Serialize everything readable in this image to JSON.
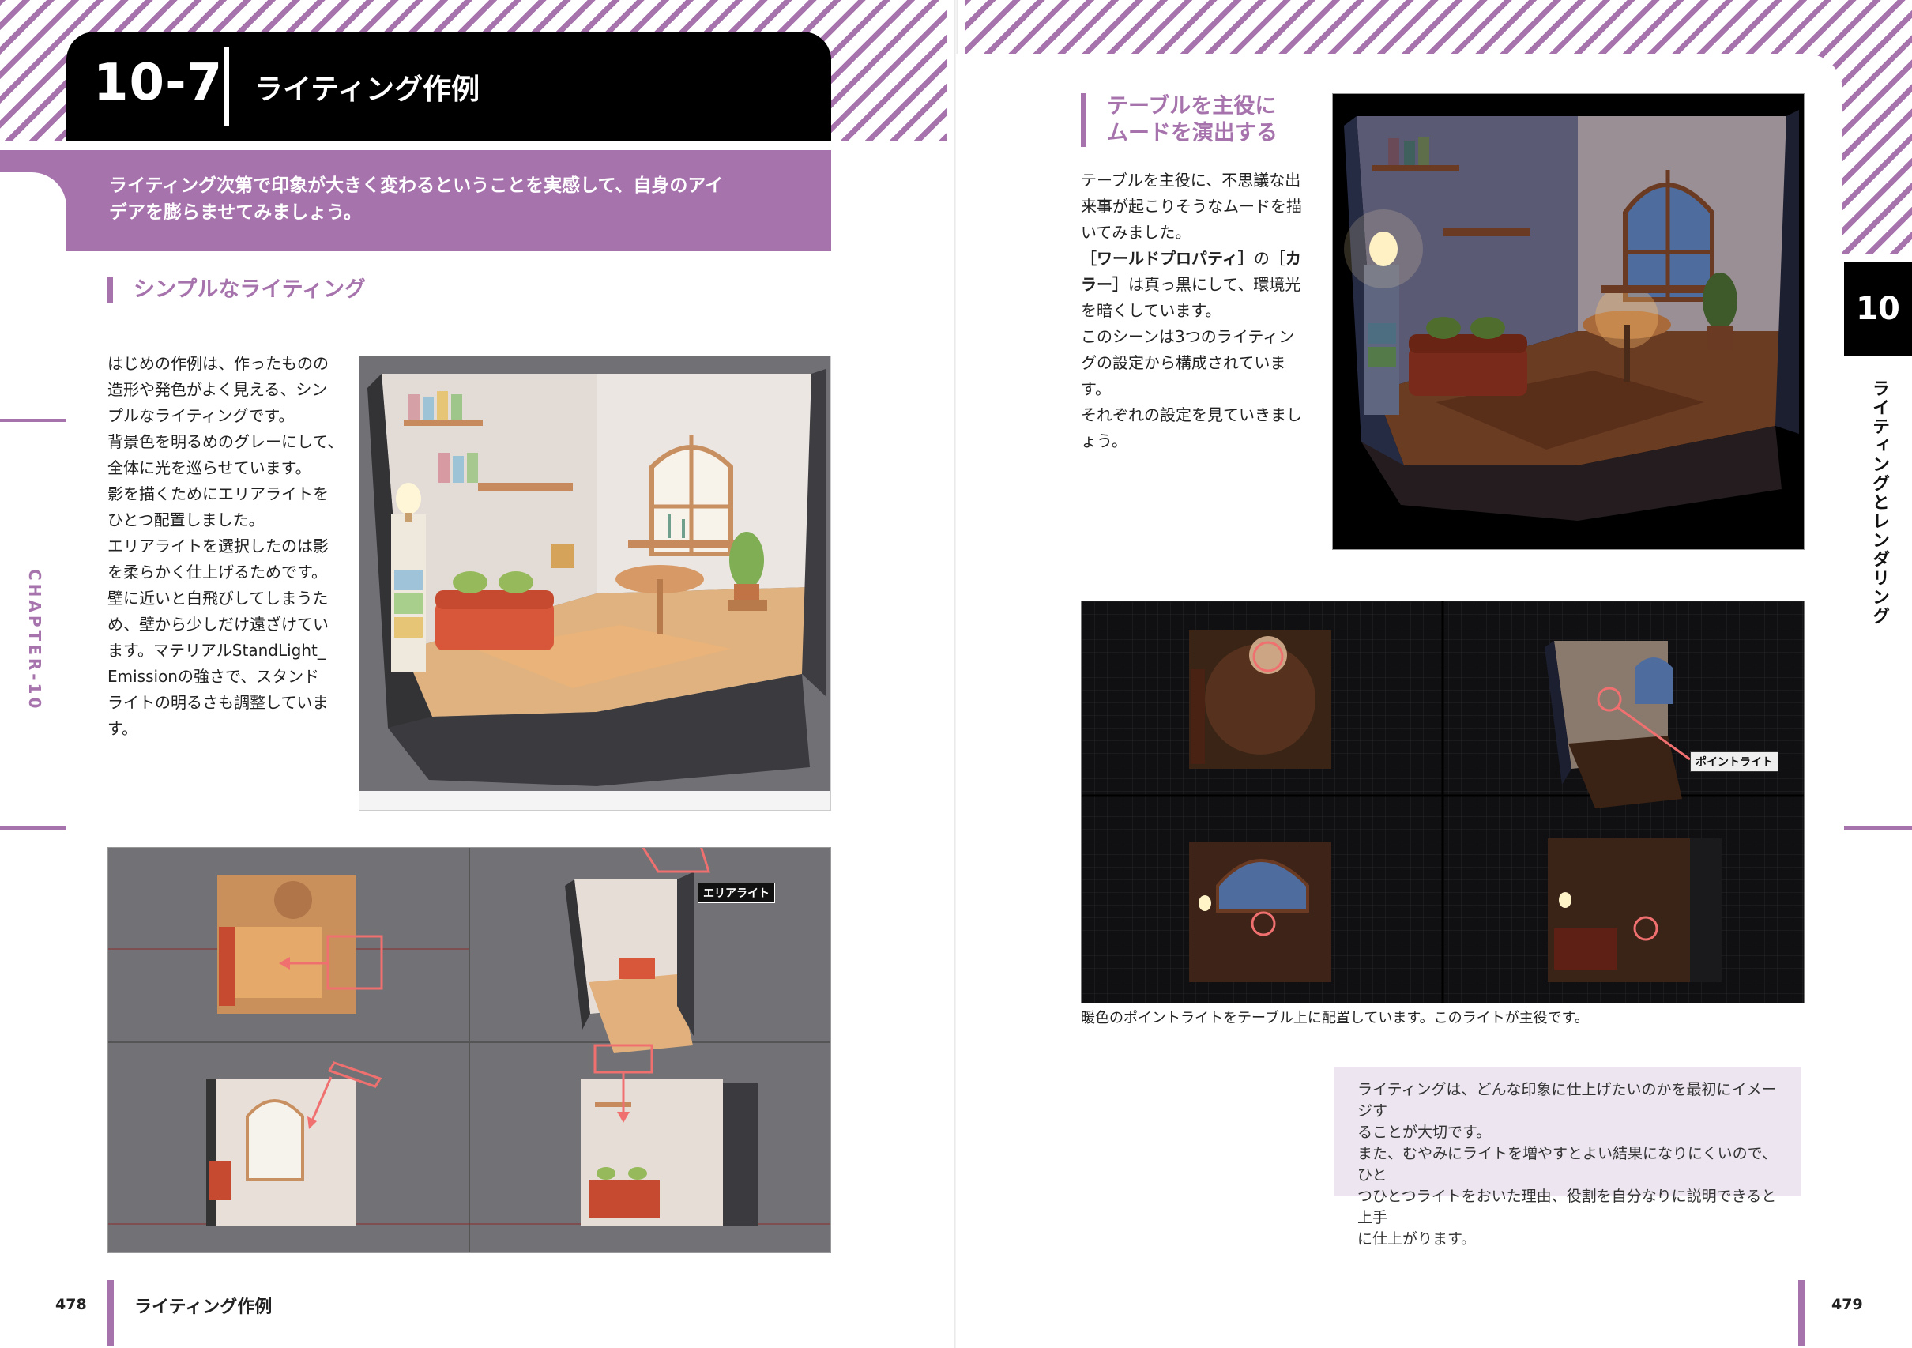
{
  "left_page": {
    "section_number": "10-7",
    "section_title": "ライティング作例",
    "intro": "ライティング次第で印象が大きく変わるということを実感して、自身のアイデアを膨らませてみましょう。",
    "heading": "シンプルなライティング",
    "body": [
      "はじめの作例は、作ったものの",
      "造形や発色がよく見える、シン",
      "プルなライティングです。",
      "背景色を明るめのグレーにして、",
      "全体に光を巡らせています。",
      "影を描くためにエリアライトを",
      "ひとつ配置しました。",
      "エリアライトを選択したのは影",
      "を柔らかく仕上げるためです。",
      "壁に近いと白飛びしてしまうた",
      "め、壁から少しだけ遠ざけてい",
      "ます。マテリアルStandLight_",
      "Emissionの強さで、スタンド",
      "ライトの明るさも調整していま",
      "す。"
    ],
    "chapter_label": "CHAPTER-10",
    "viewport_label": "エリアライト",
    "page_number": "478",
    "footer_title": "ライティング作例"
  },
  "right_page": {
    "heading_line1": "テーブルを主役に",
    "heading_line2": "ムードを演出する",
    "body": [
      "テーブルを主役に、不思議な出",
      "来事が起こりそうなムードを描",
      "いてみました。"
    ],
    "body_bold_1": "［ワールドプロパティ］",
    "body_mid_1": "の［",
    "body_bold_2": "カ",
    "body_bold_3": "ラー］",
    "body_after_1": "は真っ黒にして、環境光",
    "body_rest": [
      "を暗くしています。",
      "このシーンは3つのライティン",
      "グの設定から構成されていま",
      "す。",
      "それぞれの設定を見ていきまし",
      "ょう。"
    ],
    "viewport_label": "ポイントライト",
    "caption": "暖色のポイントライトをテーブル上に配置しています。このライトが主役です。",
    "tip": [
      "ライティングは、どんな印象に仕上げたいのかを最初にイメージす",
      "ることが大切です。",
      "また、むやみにライトを増やすとよい結果になりにくいので、ひと",
      "つひとつライトをおいた理由、役割を自分なりに説明できると上手",
      "に仕上がります。"
    ],
    "chapter_tab": "10",
    "chapter_vertical": "ライティングとレンダリング",
    "page_number": "479"
  }
}
